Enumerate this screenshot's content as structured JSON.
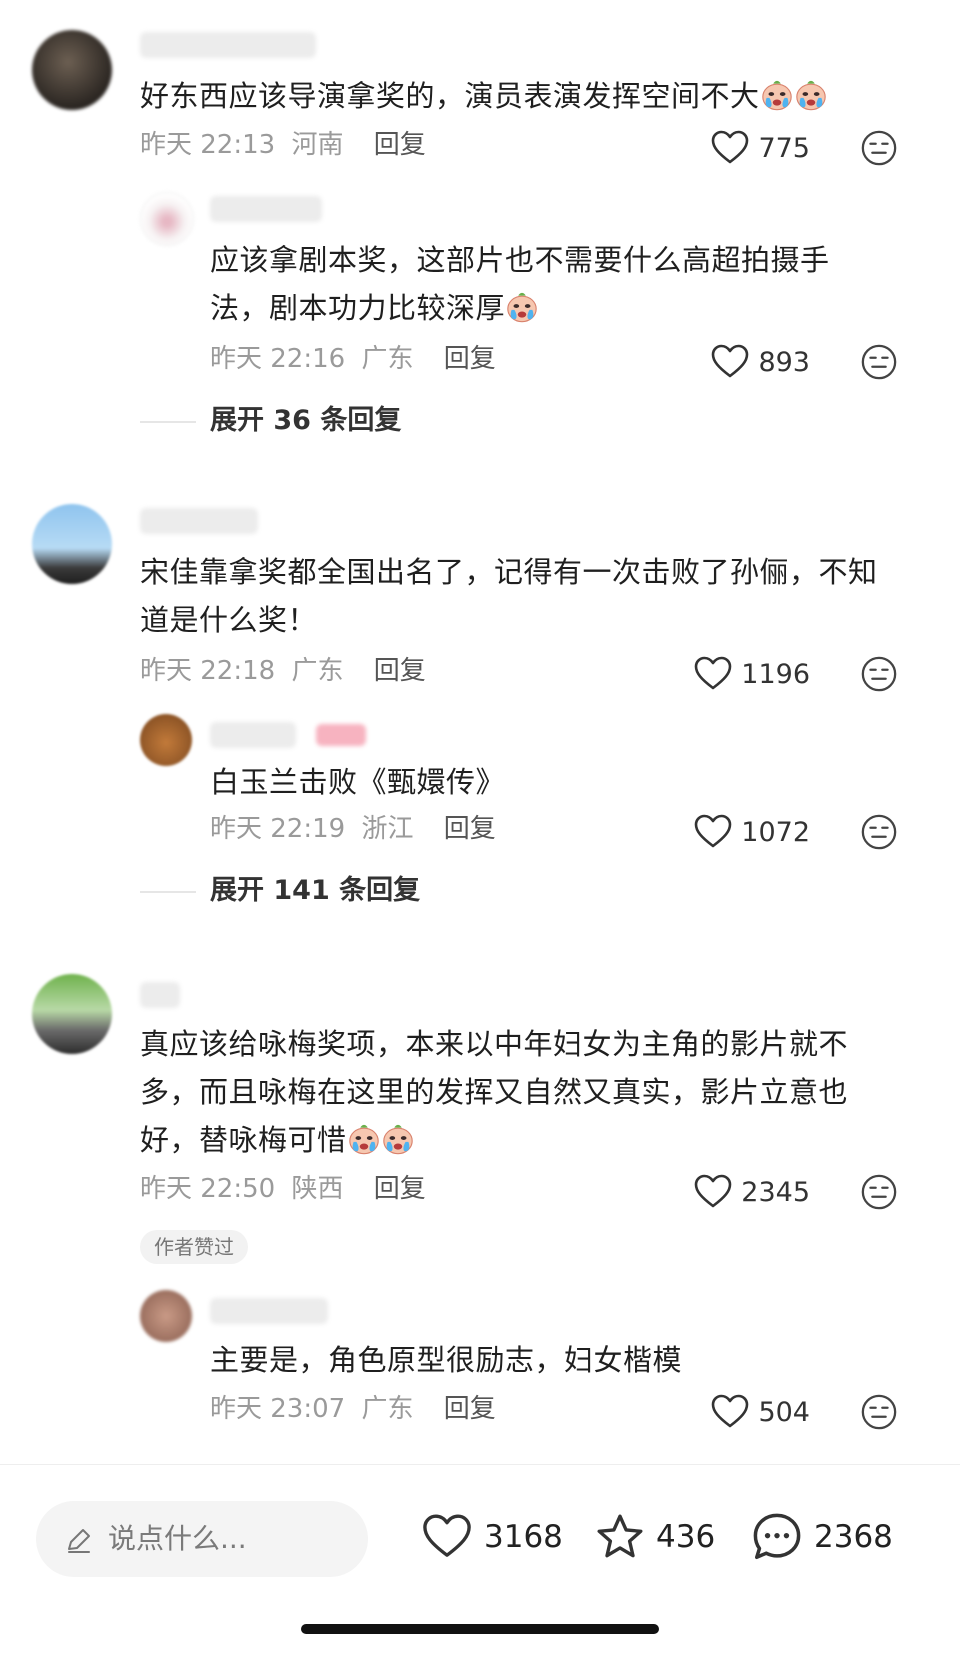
{
  "comments": [
    {
      "text": "好东西应该导演拿奖的，演员表演发挥空间不大",
      "time": "昨天 22:13",
      "location": "河南",
      "reply_label": "回复",
      "likes": "775",
      "emoji_count": 2,
      "replies": [
        {
          "text_line1": "应该拿剧本奖，这部片也不需要什么高超拍摄手",
          "text_line2": "法，剧本功力比较深厚",
          "time": "昨天 22:16",
          "location": "广东",
          "reply_label": "回复",
          "likes": "893"
        }
      ],
      "expand": "展开 36 条回复"
    },
    {
      "text_line1": "宋佳靠拿奖都全国出名了，记得有一次击败了孙俪，不知",
      "text_line2": "道是什么奖！",
      "time": "昨天 22:18",
      "location": "广东",
      "reply_label": "回复",
      "likes": "1196",
      "replies": [
        {
          "text": "白玉兰击败《甄嬛传》",
          "time": "昨天 22:19",
          "location": "浙江",
          "reply_label": "回复",
          "likes": "1072"
        }
      ],
      "expand": "展开 141 条回复"
    },
    {
      "text_line1": "真应该给咏梅奖项，本来以中年妇女为主角的影片就不",
      "text_line2": "多，而且咏梅在这里的发挥又自然又真实，影片立意也",
      "text_line3": "好，替咏梅可惜",
      "time": "昨天 22:50",
      "location": "陕西",
      "reply_label": "回复",
      "likes": "2345",
      "badge": "作者赞过",
      "replies": [
        {
          "text": "主要是，角色原型很励志，妇女楷模",
          "time": "昨天 23:07",
          "location": "广东",
          "reply_label": "回复",
          "likes": "504"
        }
      ]
    }
  ],
  "bottom_bar": {
    "input_placeholder": "说点什么...",
    "likes": "3168",
    "favorites": "436",
    "comments": "2368"
  },
  "icons": {
    "like": "heart-outline-icon",
    "dislike": "meh-face-icon",
    "edit": "pencil-icon",
    "favorite": "star-outline-icon",
    "comment": "speech-bubble-icon",
    "emoji": "crying-face-emoji"
  },
  "colors": {
    "meta": "#9a9a9a",
    "text": "#1f1f1f"
  }
}
